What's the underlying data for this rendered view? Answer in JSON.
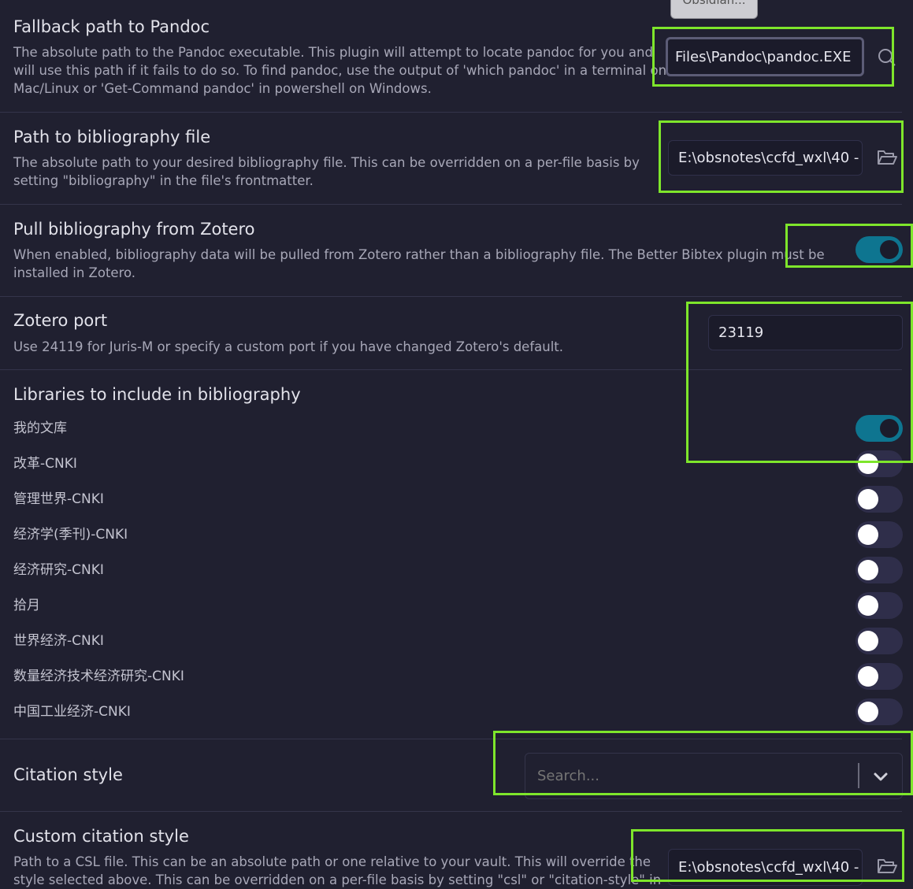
{
  "tooltip": {
    "label": "Obsidian..."
  },
  "fallback_pandoc": {
    "title": "Fallback path to Pandoc",
    "desc": [
      "The absolute path to the Pandoc executable. This plugin will attempt to locate pandoc for you and",
      "will use this path if it fails to do so. To find pandoc, use the output of 'which pandoc' in a terminal on",
      "Mac/Linux or 'Get-Command pandoc' in powershell on Windows."
    ],
    "value": "Files\\Pandoc\\pandoc.EXE",
    "icon": "search-icon"
  },
  "bibliography_path": {
    "title": "Path to bibliography file",
    "desc": [
      "The absolute path to your desired bibliography file. This can be overridden on a per-file basis by",
      "setting \"bibliography\" in the file's frontmatter."
    ],
    "value": "E:\\obsnotes\\ccfd_wxl\\40 -",
    "icon": "folder-open-icon"
  },
  "pull_zotero": {
    "title": "Pull bibliography from Zotero",
    "desc": [
      "When enabled, bibliography data will be pulled from Zotero rather than a bibliography file. The Better Bibtex plugin must be",
      "installed in Zotero."
    ],
    "enabled": true
  },
  "zotero_port": {
    "title": "Zotero port",
    "desc": "Use 24119 for Juris-M or specify a custom port if you have changed Zotero's default.",
    "value": "23119"
  },
  "libraries": {
    "title": "Libraries to include in bibliography",
    "items": [
      {
        "name": "我的文库",
        "enabled": true
      },
      {
        "name": "改革-CNKI",
        "enabled": false
      },
      {
        "name": "管理世界-CNKI",
        "enabled": false
      },
      {
        "name": "经济学(季刊)-CNKI",
        "enabled": false
      },
      {
        "name": "经济研究-CNKI",
        "enabled": false
      },
      {
        "name": "拾月",
        "enabled": false
      },
      {
        "name": "世界经济-CNKI",
        "enabled": false
      },
      {
        "name": "数量经济技术经济研究-CNKI",
        "enabled": false
      },
      {
        "name": "中国工业经济-CNKI",
        "enabled": false
      }
    ]
  },
  "citation_style": {
    "title": "Citation style",
    "placeholder": "Search...",
    "icon": "chevron-down-icon"
  },
  "custom_citation": {
    "title": "Custom citation style",
    "desc": [
      "Path to a CSL file. This can be an absolute path or one relative to your vault. This will override the",
      "style selected above. This can be overridden on a per-file basis by setting \"csl\" or \"citation-style\" in"
    ],
    "value": "E:\\obsnotes\\ccfd_wxl\\40 -",
    "icon": "folder-open-icon"
  },
  "colors": {
    "background": "#202030",
    "accent": "#0e7590",
    "highlight": "#7ee62b"
  }
}
